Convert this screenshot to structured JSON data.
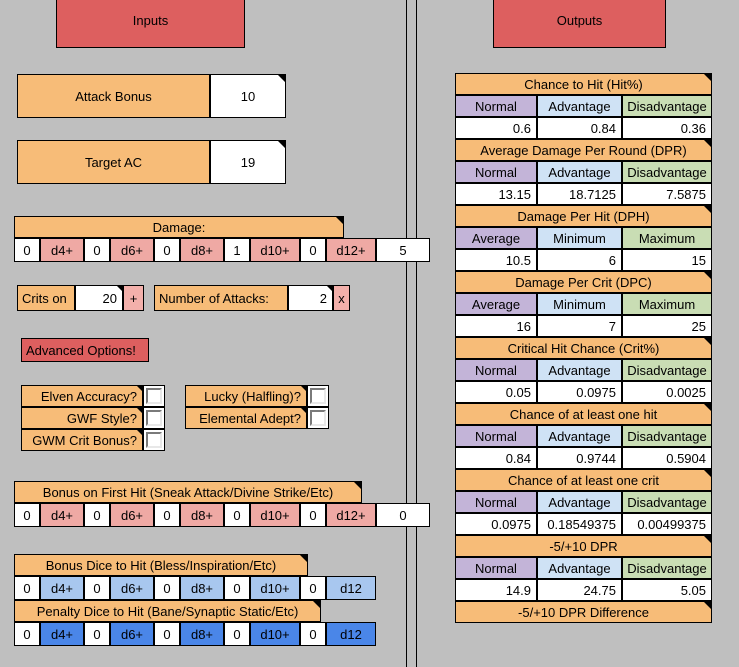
{
  "panels": {
    "inputs_title": "Inputs",
    "outputs_title": "Outputs"
  },
  "inputs": {
    "attack_bonus": {
      "label": "Attack Bonus",
      "value": "10"
    },
    "target_ac": {
      "label": "Target AC",
      "value": "19"
    },
    "damage": {
      "title": "Damage:",
      "dice": [
        {
          "count": "0",
          "die": "d4+"
        },
        {
          "count": "0",
          "die": "d6+"
        },
        {
          "count": "0",
          "die": "d8+"
        },
        {
          "count": "1",
          "die": "d10+"
        },
        {
          "count": "0",
          "die": "d12+"
        }
      ],
      "flat": "5"
    },
    "crits_on": {
      "label": "Crits on",
      "value": "20",
      "suffix": "+"
    },
    "num_attacks": {
      "label": "Number of Attacks:",
      "value": "2",
      "suffix": "x"
    },
    "advanced_options_label": "Advanced Options!",
    "options": [
      {
        "label": "Elven Accuracy?",
        "checked": false
      },
      {
        "label": "GWF Style?",
        "checked": false
      },
      {
        "label": "GWM Crit Bonus?",
        "checked": false
      },
      {
        "label": "Lucky (Halfling)?",
        "checked": false
      },
      {
        "label": "Elemental Adept?",
        "checked": false
      }
    ],
    "bonus_first_hit": {
      "title": "Bonus on First Hit (Sneak Attack/Divine Strike/Etc)",
      "dice": [
        {
          "count": "0",
          "die": "d4+"
        },
        {
          "count": "0",
          "die": "d6+"
        },
        {
          "count": "0",
          "die": "d8+"
        },
        {
          "count": "0",
          "die": "d10+"
        },
        {
          "count": "0",
          "die": "d12+"
        }
      ],
      "flat": "0"
    },
    "bonus_dice_to_hit": {
      "title": "Bonus Dice to Hit (Bless/Inspiration/Etc)",
      "dice": [
        {
          "count": "0",
          "die": "d4+"
        },
        {
          "count": "0",
          "die": "d6+"
        },
        {
          "count": "0",
          "die": "d8+"
        },
        {
          "count": "0",
          "die": "d10+"
        },
        {
          "count": "0",
          "die": "d12"
        }
      ]
    },
    "penalty_dice_to_hit": {
      "title": "Penalty Dice to Hit (Bane/Synaptic Static/Etc)",
      "dice": [
        {
          "count": "0",
          "die": "d4+"
        },
        {
          "count": "0",
          "die": "d6+"
        },
        {
          "count": "0",
          "die": "d8+"
        },
        {
          "count": "0",
          "die": "d10+"
        },
        {
          "count": "0",
          "die": "d12"
        }
      ]
    }
  },
  "outputs": {
    "tables": [
      {
        "title": "Chance to Hit (Hit%)",
        "headers": [
          "Normal",
          "Advantage",
          "Disadvantage"
        ],
        "values": [
          "0.6",
          "0.84",
          "0.36"
        ]
      },
      {
        "title": "Average Damage Per Round (DPR)",
        "headers": [
          "Normal",
          "Advantage",
          "Disadvantage"
        ],
        "values": [
          "13.15",
          "18.7125",
          "7.5875"
        ]
      },
      {
        "title": "Damage Per Hit (DPH)",
        "headers": [
          "Average",
          "Minimum",
          "Maximum"
        ],
        "values": [
          "10.5",
          "6",
          "15"
        ]
      },
      {
        "title": "Damage Per Crit (DPC)",
        "headers": [
          "Average",
          "Minimum",
          "Maximum"
        ],
        "values": [
          "16",
          "7",
          "25"
        ]
      },
      {
        "title": "Critical Hit Chance (Crit%)",
        "headers": [
          "Normal",
          "Advantage",
          "Disadvantage"
        ],
        "values": [
          "0.05",
          "0.0975",
          "0.0025"
        ]
      },
      {
        "title": "Chance of at least one hit",
        "headers": [
          "Normal",
          "Advantage",
          "Disadvantage"
        ],
        "values": [
          "0.84",
          "0.9744",
          "0.5904"
        ]
      },
      {
        "title": "Chance of at least one crit",
        "headers": [
          "Normal",
          "Advantage",
          "Disadvantage"
        ],
        "values": [
          "0.0975",
          "0.18549375",
          "0.00499375"
        ]
      },
      {
        "title": "-5/+10 DPR",
        "headers": [
          "Normal",
          "Advantage",
          "Disadvantage"
        ],
        "values": [
          "14.9",
          "24.75",
          "5.05"
        ]
      },
      {
        "title": "-5/+10 DPR Difference",
        "headers": [],
        "values": []
      }
    ]
  },
  "colors": {
    "banner": "#dd5f5f",
    "label": "#f7bc78",
    "damage_die": "#efa9a4",
    "normal": "#c3b4d8",
    "advantage": "#cfe2f5",
    "disadvantage": "#c9ddb4",
    "bonus_die": "#a8c7ef",
    "penalty_die": "#4a86e8",
    "background": "#bfbfbf"
  }
}
